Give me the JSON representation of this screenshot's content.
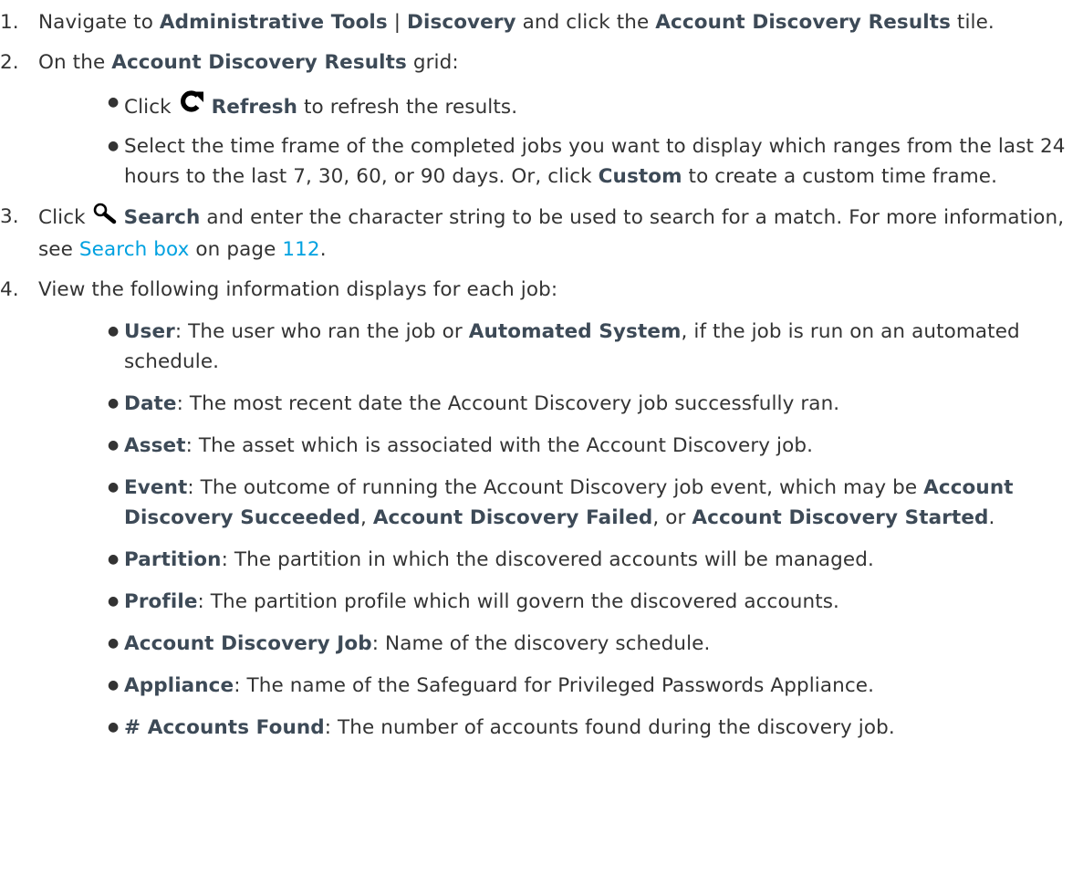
{
  "steps": [
    {
      "num": "1.",
      "p1": "Navigate to ",
      "b1": "Administrative Tools",
      "p2": " | ",
      "b2": "Discovery",
      "p3": " and click the ",
      "b3": "Account Discovery Results",
      "p4": " tile."
    },
    {
      "num": "2.",
      "p1": "On the ",
      "b1": "Account Discovery Results",
      "p2": " grid:",
      "sub": [
        {
          "p1": "Click ",
          "icon": "refresh-icon",
          "b1": "Refresh",
          "p2": " to refresh the results."
        },
        {
          "p1": "Select the time frame of the completed jobs you want to display which ranges from the last 24 hours to the last 7, 30, 60, or 90 days. Or, click ",
          "b1": "Custom",
          "p2": " to create a custom time frame."
        }
      ]
    },
    {
      "num": "3.",
      "p1": "Click ",
      "icon": "search-icon",
      "b1": "Search",
      "p2": " and enter the character string to be used to search for a match. For more information, see ",
      "link": "Search box",
      "p3": " on page ",
      "page_link": "112",
      "p4": "."
    },
    {
      "num": "4.",
      "p1": "View the following information displays for each job:",
      "sub": [
        {
          "b1": "User",
          "p1": ": The user who ran the job or ",
          "b2": "Automated System",
          "p2": ", if the job is run on an automated schedule."
        },
        {
          "b1": "Date",
          "p1": ": The most recent date the Account Discovery job successfully ran."
        },
        {
          "b1": "Asset",
          "p1": ": The asset which is associated with the Account Discovery job."
        },
        {
          "b1": "Event",
          "p1": ": The outcome of running the Account Discovery job event, which may be ",
          "b2": "Account Discovery Succeeded",
          "p2": ", ",
          "b3": "Account Discovery Failed",
          "p3": ", or ",
          "b4": "Account Discovery Started",
          "p4": "."
        },
        {
          "b1": "Partition",
          "p1": ": The partition in which the discovered accounts will be managed."
        },
        {
          "b1": "Profile",
          "p1": ": The partition profile which will govern the discovered accounts."
        },
        {
          "b1": "Account Discovery Job",
          "p1": ": Name of the discovery schedule."
        },
        {
          "b1": "Appliance",
          "p1": ": The name of the Safeguard for Privileged Passwords Appliance."
        },
        {
          "b1": "# Accounts Found",
          "p1": ": The number of accounts found during the discovery job."
        }
      ]
    }
  ]
}
